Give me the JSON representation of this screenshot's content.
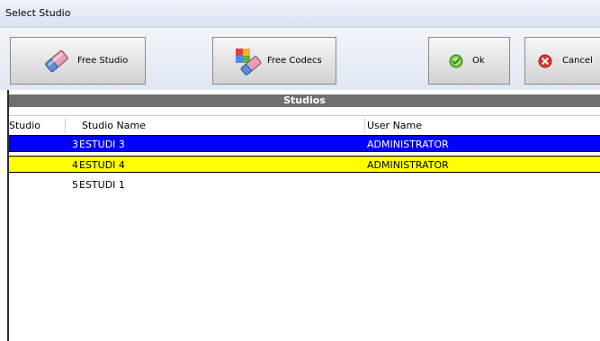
{
  "window": {
    "title": "Select Studio"
  },
  "toolbar": {
    "free_studio": {
      "label": "Free Studio",
      "icon": "eraser-icon"
    },
    "free_codecs": {
      "label": "Free Codecs",
      "icon": "codecs-eraser-icon"
    },
    "ok": {
      "label": "Ok",
      "icon": "check-circle-icon",
      "color": "#5cb531"
    },
    "cancel": {
      "label": "Cancel",
      "icon": "cancel-circle-icon",
      "color": "#d73b2e"
    }
  },
  "studios": {
    "header": "Studios",
    "columns": [
      "Studio",
      "Studio Name",
      "User Name"
    ],
    "rows": [
      {
        "studio": "3",
        "name": "ESTUDI 3",
        "user": "ADMINISTRATOR",
        "state": "selected",
        "color": "#0000ff"
      },
      {
        "studio": "4",
        "name": "ESTUDI 4",
        "user": "ADMINISTRATOR",
        "state": "highlighted",
        "color": "#ffff00"
      },
      {
        "studio": "5",
        "name": "ESTUDI 1",
        "user": "",
        "state": "normal",
        "color": "#ffffff"
      }
    ]
  }
}
